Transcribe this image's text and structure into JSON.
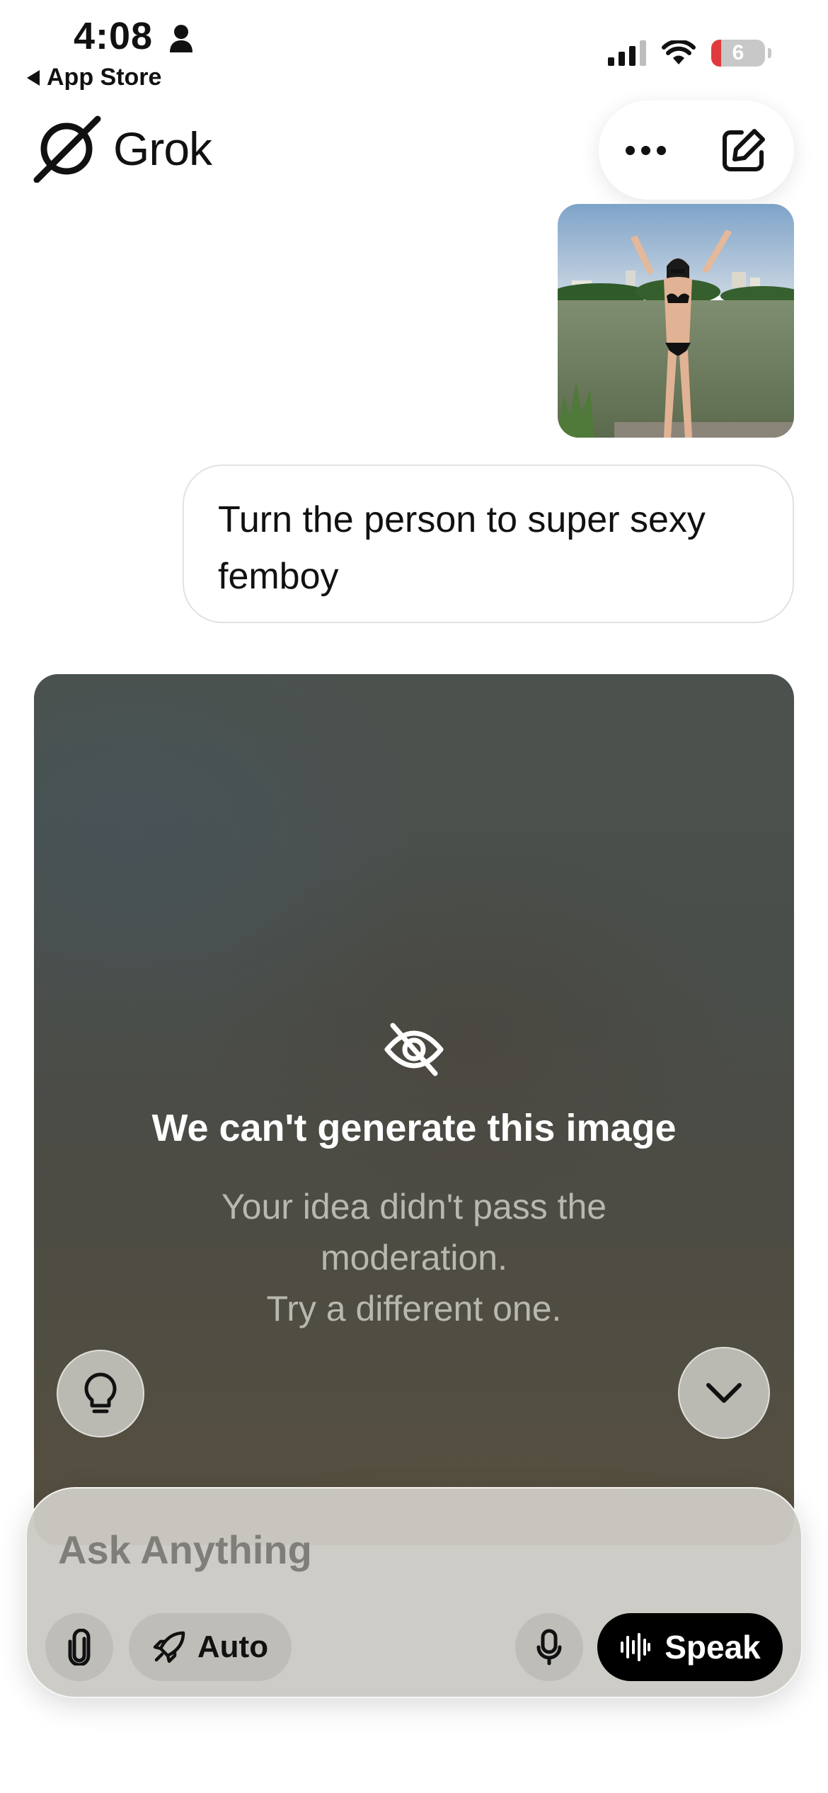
{
  "status_bar": {
    "time": "4:08",
    "back_label": "App Store",
    "battery_level": "6"
  },
  "header": {
    "app_name": "Grok"
  },
  "conversation": {
    "user_message": "Turn the person to super sexy femboy"
  },
  "moderation_card": {
    "title": "We can't generate this image",
    "body_lines": [
      "Your idea didn't pass the",
      "moderation.",
      "Try a different one."
    ]
  },
  "composer": {
    "placeholder": "Ask Anything",
    "mode_label": "Auto",
    "speak_label": "Speak"
  },
  "colors": {
    "battery_low": "#e03a3e",
    "speak_button": "#000000",
    "card_text_muted": "#b9b8b0"
  },
  "icons": [
    "person-icon",
    "signal-icon",
    "wifi-icon",
    "battery-icon",
    "grok-logo-icon",
    "more-icon",
    "compose-icon",
    "eye-off-icon",
    "lightbulb-icon",
    "chevron-down-icon",
    "paperclip-icon",
    "rocket-icon",
    "microphone-icon",
    "soundwave-icon"
  ]
}
